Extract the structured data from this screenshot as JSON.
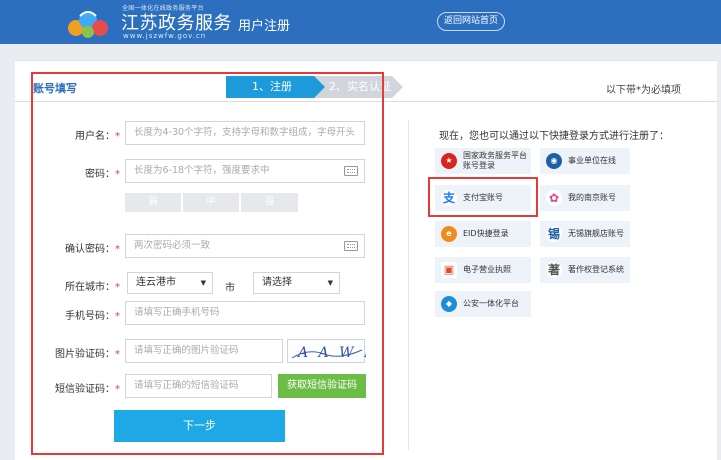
{
  "header": {
    "logo_tagline": "全国一体化在线政务服务平台",
    "logo_name": "江苏政务服务",
    "logo_url": "www.jszwfw.gov.cn",
    "page_title": "用户注册",
    "back_link": "返回网站首页"
  },
  "steps": {
    "section_title": "账号填写",
    "step1": "1、注册",
    "step2": "2、实名认证",
    "required_note": "以下带*为必填项"
  },
  "form": {
    "username": {
      "label": "用户名：",
      "placeholder": "长度为4-30个字符，支持字母和数字组成，字母开头"
    },
    "password": {
      "label": "密码：",
      "placeholder": "长度为6-18个字符，强度要求中"
    },
    "strength": [
      "弱",
      "中",
      "强"
    ],
    "confirm": {
      "label": "确认密码：",
      "placeholder": "两次密码必须一致"
    },
    "city": {
      "label": "所在城市：",
      "city_value": "连云港市",
      "unit": "市",
      "district_value": "请选择"
    },
    "phone": {
      "label": "手机号码：",
      "placeholder": "请填写正确手机号码"
    },
    "image_code": {
      "label": "图片验证码：",
      "placeholder": "请填写正确的图片验证码",
      "captcha_text": "A A W L"
    },
    "sms_code": {
      "label": "短信验证码：",
      "placeholder": "请填写正确的短信验证码",
      "button": "获取短信验证码"
    },
    "required_mark": "*",
    "next_button": "下一步"
  },
  "quick_login": {
    "title": "现在，您也可以通过以下快捷登录方式进行注册了：",
    "items": [
      {
        "label_1": "国家政务服务平台",
        "label_2": "账号登录",
        "icon": "national-emblem-icon",
        "color": "#d9261c"
      },
      {
        "label_1": "事业单位在线",
        "icon": "institution-globe-icon",
        "color": "#1f5fa8"
      },
      {
        "label_1": "支付宝账号",
        "icon": "alipay-icon",
        "color": "#1677ff"
      },
      {
        "label_1": "我的南京账号",
        "icon": "nanjing-flower-icon",
        "color": "#e0468a"
      },
      {
        "label_1": "EID快捷登录",
        "icon": "eid-icon",
        "color": "#f08c1a"
      },
      {
        "label_1": "无锡旗舰店账号",
        "icon": "wuxi-icon",
        "color": "#1f5fa8"
      },
      {
        "label_1": "电子营业执照",
        "icon": "business-license-icon",
        "color": "#e04a2e"
      },
      {
        "label_1": "著作权登记系统",
        "icon": "copyright-icon",
        "color": "#555555"
      },
      {
        "label_1": "公安一体化平台",
        "icon": "police-shield-icon",
        "color": "#1a8fd6"
      }
    ]
  },
  "colors": {
    "header_bg": "#2c6fbe",
    "accent": "#1ea9e6",
    "sms_button": "#6bbd45",
    "highlight": "#e53a3a"
  }
}
